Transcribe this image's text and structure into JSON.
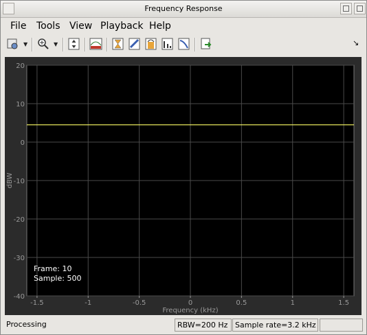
{
  "window": {
    "title": "Frequency Response"
  },
  "menu": {
    "items": [
      {
        "label": "File",
        "mnemonic": "F"
      },
      {
        "label": "Tools",
        "mnemonic": "T"
      },
      {
        "label": "View",
        "mnemonic": "V"
      },
      {
        "label": "Playback",
        "mnemonic": "P"
      },
      {
        "label": "Help",
        "mnemonic": "H"
      }
    ]
  },
  "toolbar": {
    "icons": [
      "settings-icon",
      "zoom-in-icon",
      "scale-axes-icon",
      "spectrum-settings-icon",
      "cursor-measurement-icon",
      "peak-finder-icon",
      "channel-measurement-icon",
      "distortion-measurement-icon",
      "ccdf-icon",
      "export-icon"
    ]
  },
  "chart_data": {
    "type": "line",
    "xlabel": "Frequency (kHz)",
    "ylabel": "dBW",
    "xlim": [
      -1.6,
      1.6
    ],
    "ylim": [
      -40,
      20
    ],
    "xticks": [
      -1.5,
      -1,
      -0.5,
      0,
      0.5,
      1,
      1.5
    ],
    "xtick_labels": [
      "-1.5",
      "-1",
      "-0.5",
      "0",
      "0.5",
      "1",
      "1.5"
    ],
    "yticks": [
      -40,
      -30,
      -20,
      -10,
      0,
      10,
      20
    ],
    "ytick_labels": [
      "-40",
      "-30",
      "-20",
      "-10",
      "0",
      "10",
      "20"
    ],
    "grid": true,
    "series": [
      {
        "x": [
          -1.6,
          1.6
        ],
        "y": [
          4.5,
          4.5
        ],
        "color": "#ffff66"
      }
    ],
    "annotations": {
      "frame": "Frame: 10",
      "sample": "Sample: 500"
    }
  },
  "status": {
    "state": "Processing",
    "rbw": "RBW=200 Hz",
    "sample_rate": "Sample rate=3.2 kHz",
    "extra": ""
  }
}
